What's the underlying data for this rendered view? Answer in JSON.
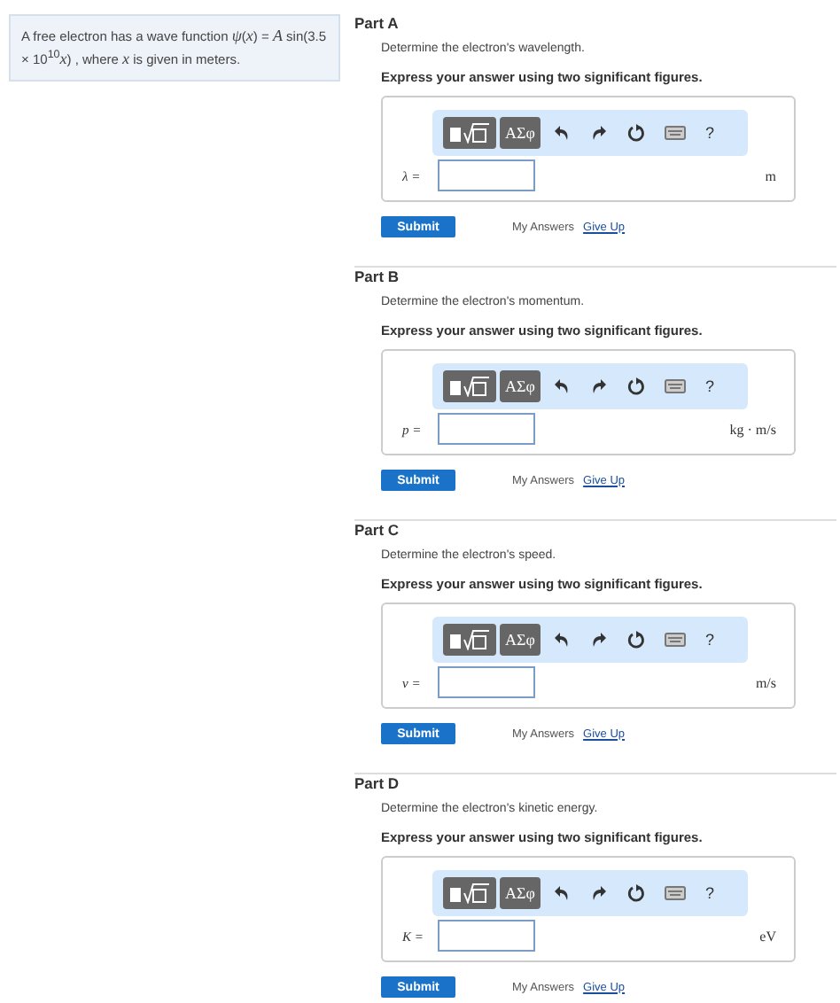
{
  "problem": {
    "text": "A free electron has a wave function *ψ*(*x*) = *A* sin(3.5 × 10$^{10}$*x*) , where *x* is given in meters."
  },
  "parts": [
    {
      "title": "Part A",
      "question": "Determine the electron's wavelength.",
      "instruction": "Express your answer using two significant figures.",
      "toolbar": {
        "symbols": "ΑΣφ",
        "help": "?"
      },
      "variable": "λ =",
      "unit": "m",
      "submit": "Submit",
      "my_answers": "My Answers",
      "give_up": "Give Up"
    },
    {
      "title": "Part B",
      "question": "Determine the electron's momentum.",
      "instruction": "Express your answer using two significant figures.",
      "toolbar": {
        "symbols": "ΑΣφ",
        "help": "?"
      },
      "variable": "p =",
      "unit": "kg · m/s",
      "submit": "Submit",
      "my_answers": "My Answers",
      "give_up": "Give Up"
    },
    {
      "title": "Part C",
      "question": "Determine the electron's speed.",
      "instruction": "Express your answer using two significant figures.",
      "toolbar": {
        "symbols": "ΑΣφ",
        "help": "?"
      },
      "variable": "v =",
      "unit": "m/s",
      "submit": "Submit",
      "my_answers": "My Answers",
      "give_up": "Give Up"
    },
    {
      "title": "Part D",
      "question": "Determine the electron's kinetic energy.",
      "instruction": "Express your answer using two significant figures.",
      "toolbar": {
        "symbols": "ΑΣφ",
        "help": "?"
      },
      "variable": "K =",
      "unit": "eV",
      "submit": "Submit",
      "my_answers": "My Answers",
      "give_up": "Give Up"
    }
  ]
}
